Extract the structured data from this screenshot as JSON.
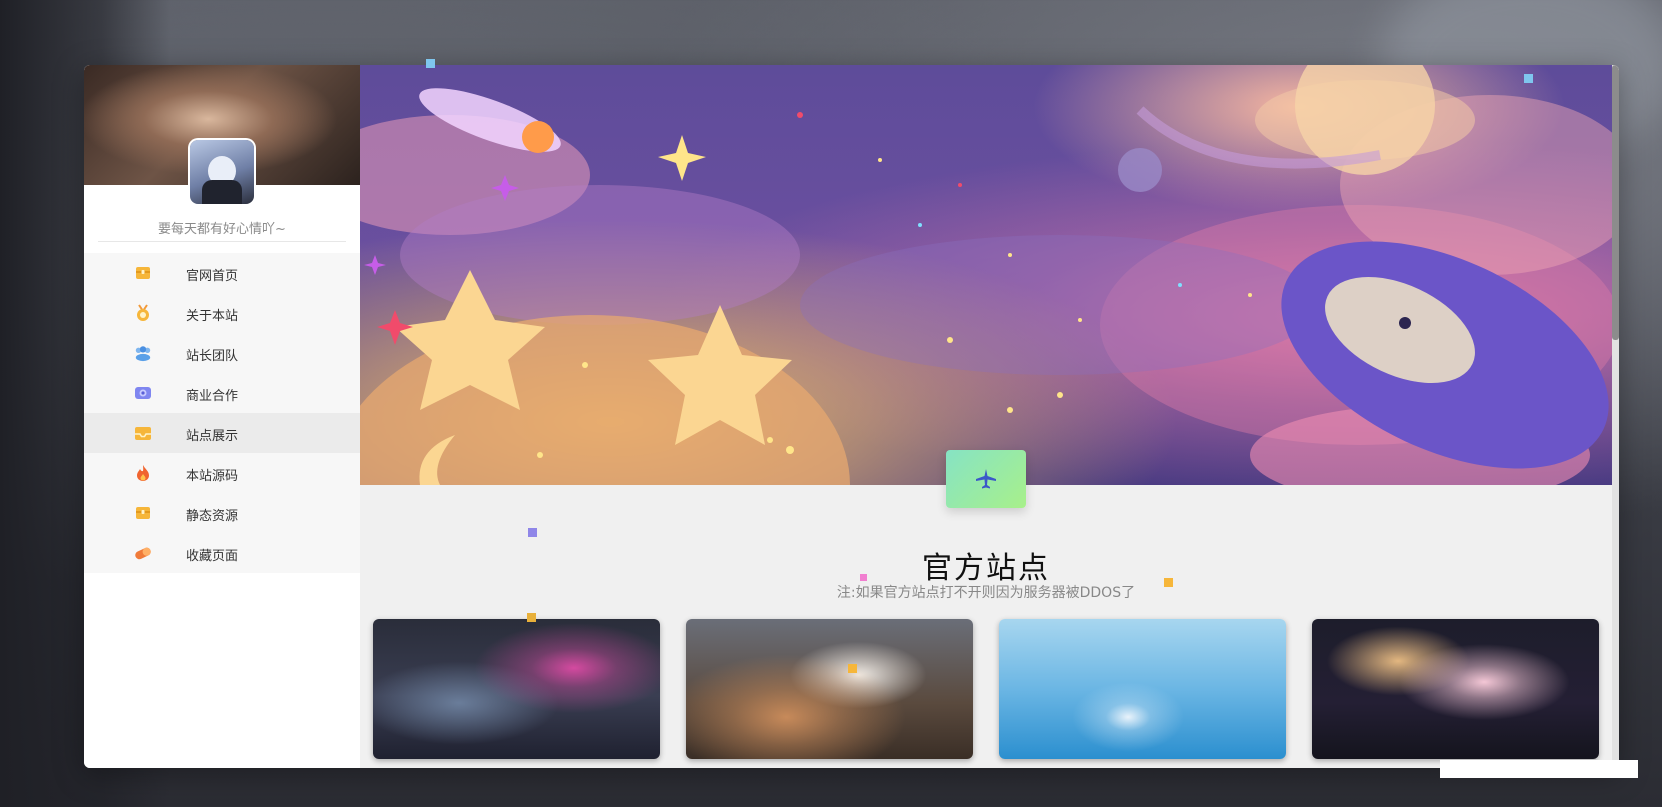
{
  "sidebar": {
    "motto": "要每天都有好心情吖~",
    "items": [
      {
        "label": "官网首页",
        "icon": "chest-icon",
        "color": "#f6b63a"
      },
      {
        "label": "关于本站",
        "icon": "medal-icon",
        "color": "#f29a3a"
      },
      {
        "label": "站长团队",
        "icon": "team-icon",
        "color": "#5aa0e8"
      },
      {
        "label": "商业合作",
        "icon": "camera-icon",
        "color": "#7f86f0"
      },
      {
        "label": "站点展示",
        "icon": "inbox-icon",
        "color": "#f6b63a"
      },
      {
        "label": "本站源码",
        "icon": "fire-icon",
        "color": "#f0642f"
      },
      {
        "label": "静态资源",
        "icon": "chest-icon",
        "color": "#f6b63a"
      },
      {
        "label": "收藏页面",
        "icon": "capsule-icon",
        "color": "#f07b3a"
      }
    ],
    "active_index": 4
  },
  "section": {
    "title": "官方站点",
    "note": "注:如果官方站点打不开则因为服务器被DDOS了"
  },
  "colors": {
    "accent_gradient_start": "#86e3c4",
    "accent_gradient_end": "#a8f08a"
  }
}
